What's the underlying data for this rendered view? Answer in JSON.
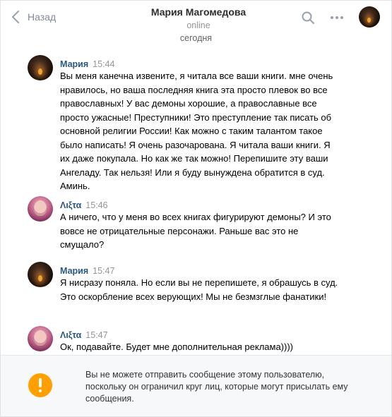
{
  "header": {
    "back_label": "Назад",
    "title": "Мария Магомедова",
    "status": "online"
  },
  "date_separator": "сегодня",
  "messages": [
    {
      "author": "Мария",
      "time": "15:44",
      "text": "Вы меня канечна извените, я читала все ваши книги. мне очень нравилось, но ваша последняя книга эта просто плевок во все православных! У вас демоны хорошие, а православные все просто ужасные! Преступники! Это преступление так писать об основной религии России! Как можно с таким талантом такое было написать! Я очень разочарована. Я читала ваши книги. Я их даже покупала. Но как же так можно! Перепишите эту ваши Ангеладу. Так нельзя! Или я буду вынуждена обратится в суд. Аминь."
    },
    {
      "author": "Λιξτα",
      "time": "15:46",
      "text": "А ничего, что у меня во всех книгах фигурируют демоны? И это вовсе не отрицательные персонажи. Раньше вас это не смущало?"
    },
    {
      "author": "Мария",
      "time": "15:47",
      "text": "Я нисразу поняла. Но если вы не перепишете, я обрашусь в суд. Это оскорбление всех верующих! Мы не безмзглые фанатики!"
    },
    {
      "author": "Λιξτα",
      "time": "15:47",
      "text": "Ок, подавайте. Будет мне дополнительная реклама))))"
    }
  ],
  "footer": {
    "notice": "Вы не можете отправить сообщение этому пользователю, поскольку он ограничил круг лиц, которые могут присылать ему сообщения."
  },
  "colors": {
    "author_link": "#2a5885",
    "warning": "#ffa000",
    "muted": "#939699"
  },
  "icons": [
    "chevron-left-icon",
    "search-icon",
    "more-dots-icon",
    "warning-icon"
  ]
}
